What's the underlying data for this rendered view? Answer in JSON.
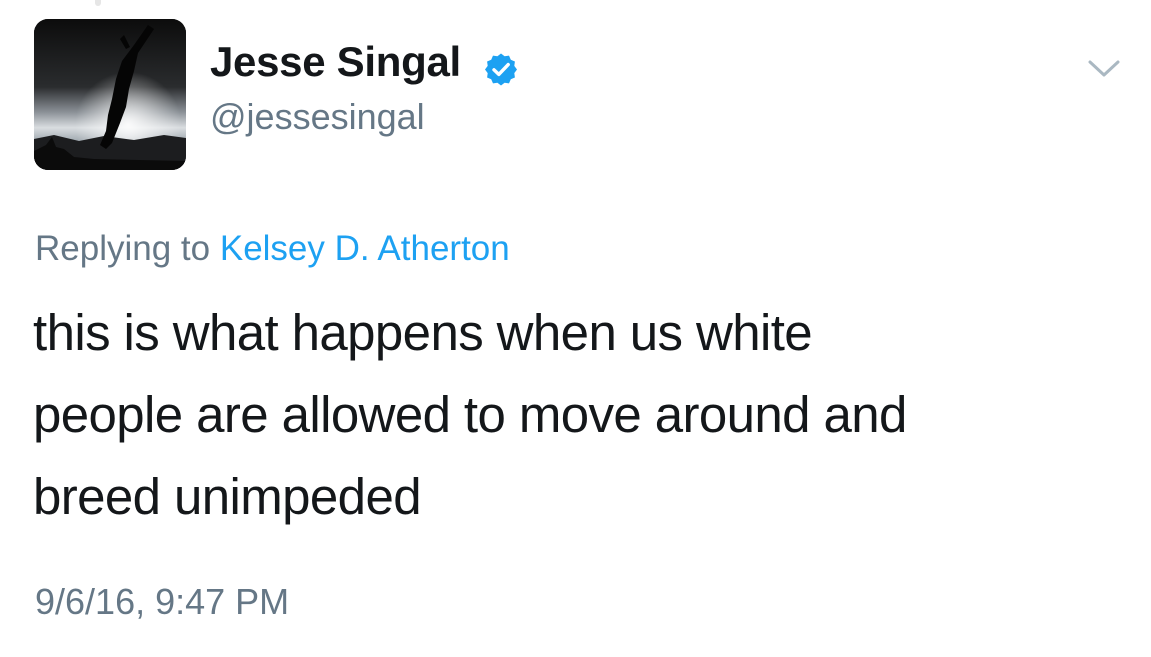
{
  "author": {
    "display_name": "Jesse Singal",
    "handle": "@jessesingal",
    "verified": true,
    "avatar_icon": "person-silhouette-jumping-avatar",
    "verified_icon": "verified-badge-icon",
    "verified_color": "#1da1f2"
  },
  "menu": {
    "icon": "chevron-down-icon"
  },
  "reply": {
    "prefix": "Replying to",
    "target": "Kelsey D. Atherton"
  },
  "tweet": {
    "text_lines": [
      "this is what happens when us white",
      "people are allowed to move around and",
      "breed unimpeded"
    ],
    "timestamp": "9/6/16, 9:47 PM"
  },
  "colors": {
    "text_primary": "#14171a",
    "text_secondary": "#657786",
    "link": "#1da1f2"
  }
}
